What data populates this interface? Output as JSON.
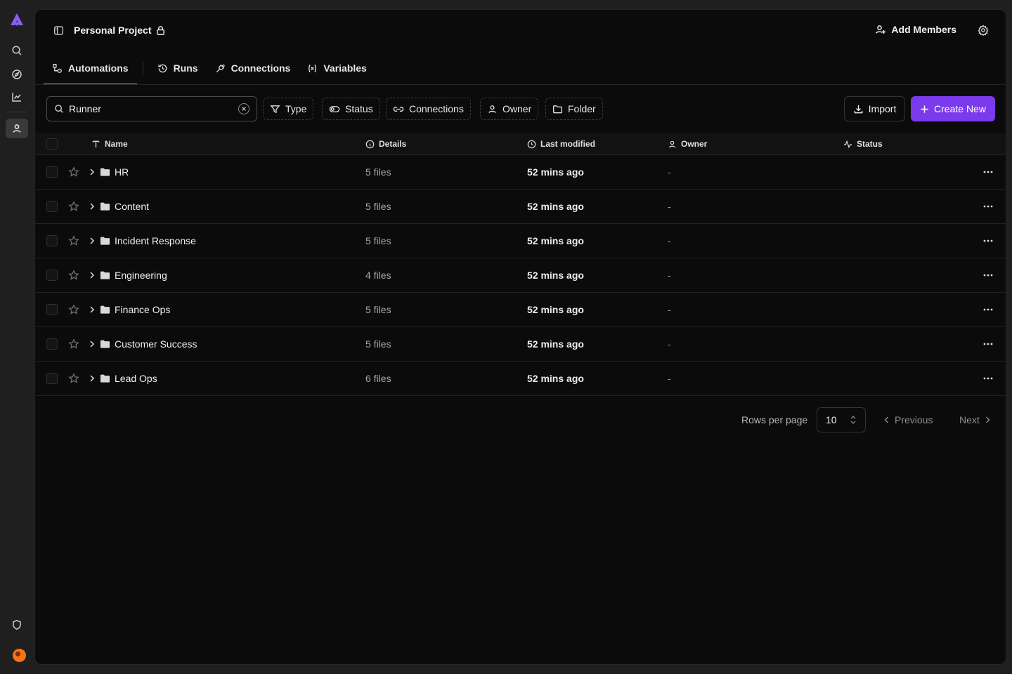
{
  "colors": {
    "accent": "#7c3aed",
    "logo": "#8b5cf6",
    "background": "#0b0b0b",
    "rail": "#1f1f1f"
  },
  "rail": {
    "icons": [
      "logo-icon",
      "search-icon",
      "compass-icon",
      "chart-icon",
      "user-icon",
      "shield-icon",
      "avatar"
    ]
  },
  "header": {
    "project_title": "Personal Project",
    "add_members": "Add Members"
  },
  "tabs": [
    {
      "label": "Automations",
      "icon": "automations-icon",
      "active": true
    },
    {
      "label": "Runs",
      "icon": "history-icon"
    },
    {
      "label": "Connections",
      "icon": "plug-icon"
    },
    {
      "label": "Variables",
      "icon": "variable-icon"
    }
  ],
  "toolbar": {
    "search_value": "Runner",
    "filters": [
      "Type",
      "Status",
      "Connections",
      "Owner",
      "Folder"
    ],
    "import_label": "Import",
    "create_label": "Create New"
  },
  "table": {
    "columns": {
      "name": "Name",
      "details": "Details",
      "last_modified": "Last modified",
      "owner": "Owner",
      "status": "Status"
    },
    "rows": [
      {
        "name": "HR",
        "details": "5 files",
        "modified": "52 mins ago",
        "owner": "-"
      },
      {
        "name": "Content",
        "details": "5 files",
        "modified": "52 mins ago",
        "owner": "-"
      },
      {
        "name": "Incident Response",
        "details": "5 files",
        "modified": "52 mins ago",
        "owner": "-"
      },
      {
        "name": "Engineering",
        "details": "4 files",
        "modified": "52 mins ago",
        "owner": "-"
      },
      {
        "name": "Finance Ops",
        "details": "5 files",
        "modified": "52 mins ago",
        "owner": "-"
      },
      {
        "name": "Customer Success",
        "details": "5 files",
        "modified": "52 mins ago",
        "owner": "-"
      },
      {
        "name": "Lead Ops",
        "details": "6 files",
        "modified": "52 mins ago",
        "owner": "-"
      }
    ]
  },
  "pagination": {
    "rows_per_page_label": "Rows per page",
    "rows_per_page_value": "10",
    "previous": "Previous",
    "next": "Next"
  }
}
